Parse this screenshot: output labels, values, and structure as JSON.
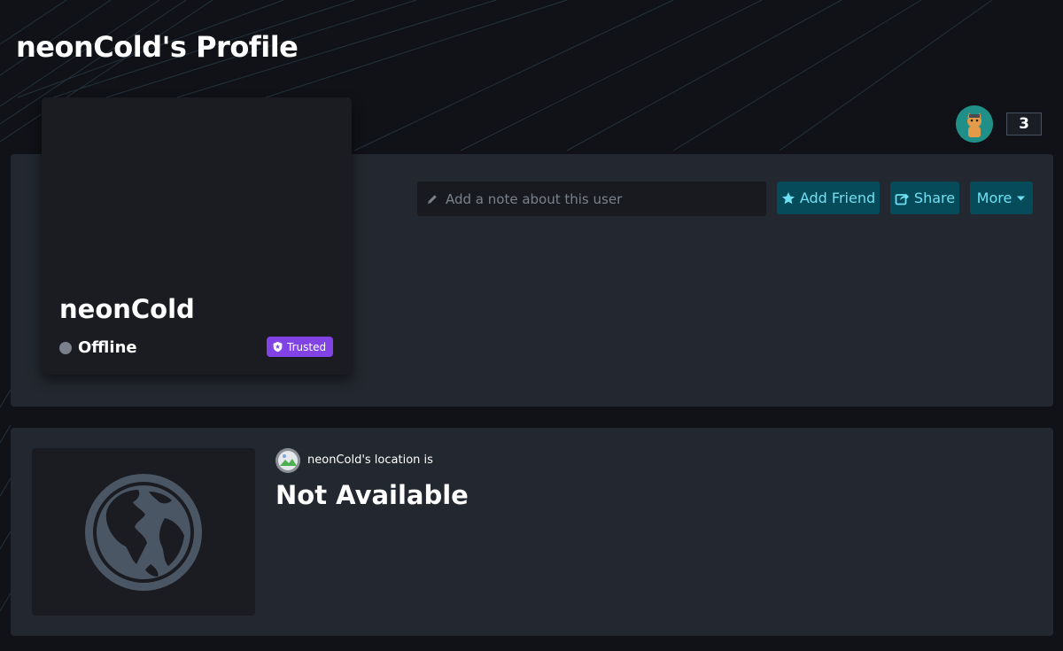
{
  "page": {
    "title": "neonCold's Profile"
  },
  "header": {
    "avatar_icon": "cat-avatar-icon",
    "count": "3"
  },
  "profile": {
    "username": "neonCold",
    "status": "Offline",
    "status_color": "#7a808c",
    "badge": "Trusted",
    "badge_color": "#8143e6",
    "badge_icon": "shield-icon"
  },
  "note": {
    "placeholder": "Add a note about this user",
    "value": ""
  },
  "actions": {
    "add_friend": "Add Friend",
    "share": "Share",
    "more": "More"
  },
  "location": {
    "label": "neonCold's location is",
    "value": "Not Available",
    "icon": "globe-icon"
  },
  "colors": {
    "accent_button_bg": "#064b5a",
    "accent_button_text": "#6fe0f3",
    "panel_bg": "#23272f",
    "page_bg": "#101217"
  }
}
